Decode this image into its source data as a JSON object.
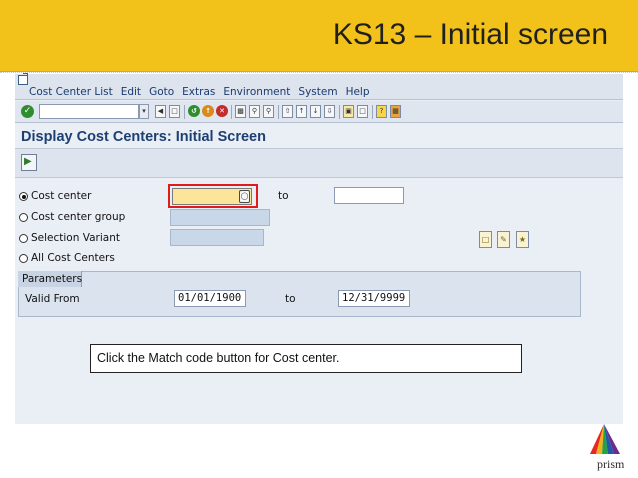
{
  "slide": {
    "title": "KS13 – Initial screen"
  },
  "menu": [
    "Cost Center List",
    "Edit",
    "Goto",
    "Extras",
    "Environment",
    "System",
    "Help"
  ],
  "screen": {
    "title": "Display Cost Centers: Initial Screen"
  },
  "selection": {
    "cost_center_label": "Cost center",
    "cost_center_value": "",
    "cost_center_to_label": "to",
    "cost_center_group_label": "Cost center group",
    "selection_variant_label": "Selection Variant",
    "all_cost_centers_label": "All Cost Centers",
    "selected_option": "Cost center"
  },
  "parameters": {
    "section_label": "Parameters",
    "valid_from_label": "Valid From",
    "valid_from_value": "01/01/1900",
    "to_label": "to",
    "valid_to_value": "12/31/9999"
  },
  "callout": {
    "text": "Click the Match code button for Cost center."
  },
  "logo": {
    "text": "prism"
  },
  "colors": {
    "title_band": "#f2c21a",
    "sap_background": "#eaeef5",
    "active_field": "#fde49b",
    "highlight_red": "#e01b1b",
    "screen_title": "#1d3f72"
  }
}
